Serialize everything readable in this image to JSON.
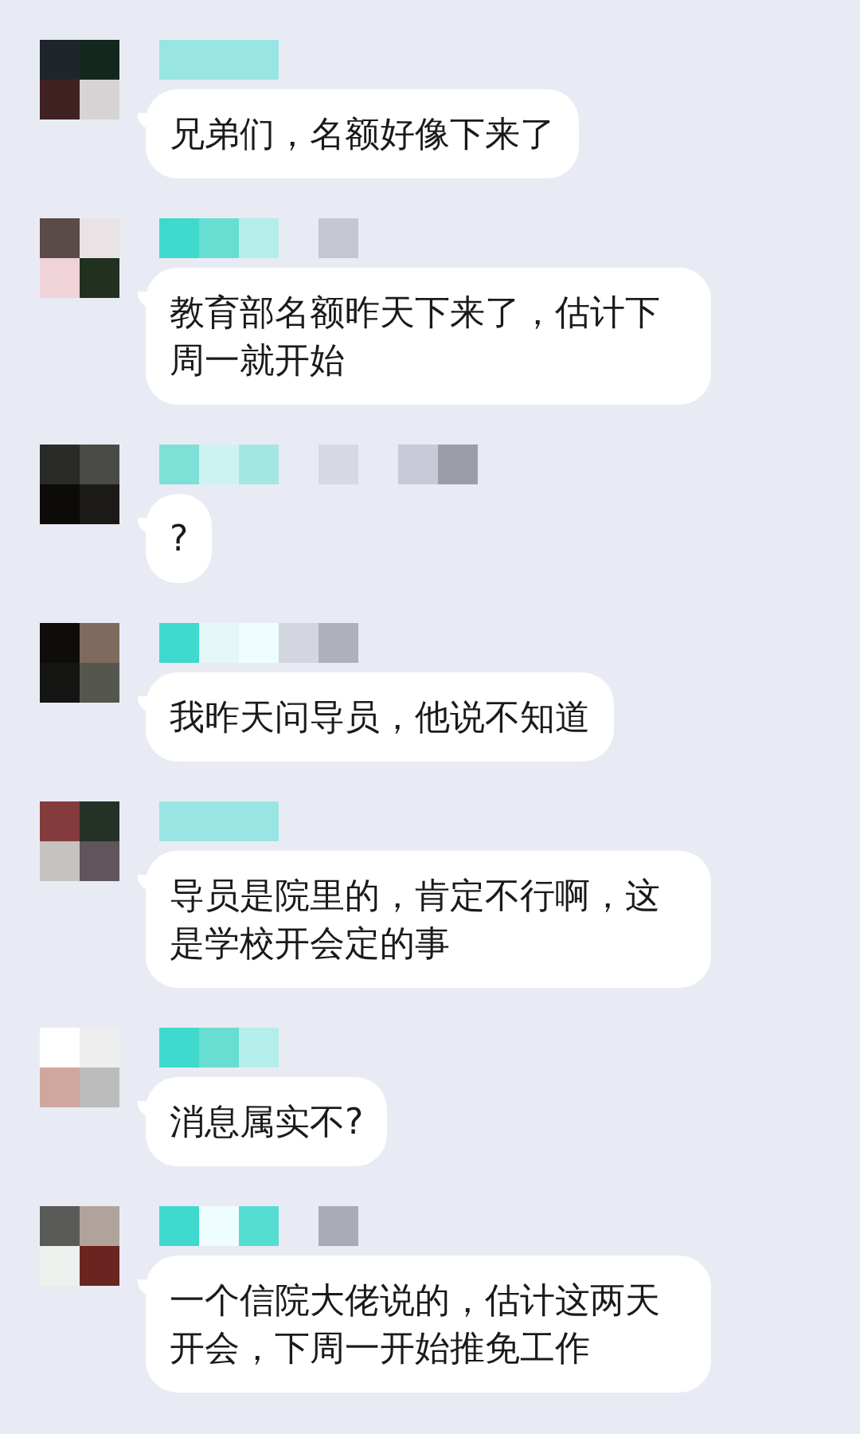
{
  "messages": [
    {
      "text": "兄弟们，名额好像下来了"
    },
    {
      "text": "教育部名额昨天下来了，估计下周一就开始"
    },
    {
      "text": "?"
    },
    {
      "text": "我昨天问导员，他说不知道"
    },
    {
      "text": "导员是院里的，肯定不行啊，这是学校开会定的事"
    },
    {
      "text": "消息属实不?"
    },
    {
      "text": "一个信院大佬说的，估计这两天开会，下周一开始推免工作"
    }
  ]
}
